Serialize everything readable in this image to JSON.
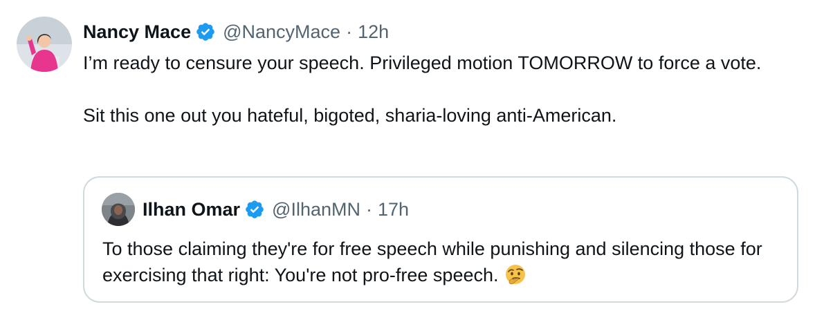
{
  "tweet": {
    "author_name": "Nancy Mace",
    "author_handle": "@NancyMace",
    "separator": "·",
    "time": "12h",
    "verified_icon": "verified-badge-icon",
    "paragraphs": [
      "I’m ready to censure your speech. Privileged motion TOMORROW to force a vote.",
      "Sit this one out you hateful, bigoted, sharia-loving anti-American."
    ]
  },
  "quote": {
    "author_name": "Ilhan Omar",
    "author_handle": "@IlhanMN",
    "separator": "·",
    "time": "17h",
    "verified_icon": "verified-badge-icon",
    "text": "To those claiming they're for free speech while punishing and silencing those for exercising that right: You're not pro-free speech.",
    "emoji_icon": "thinking-face-emoji-icon"
  },
  "colors": {
    "text_primary": "#0f1419",
    "text_secondary": "#536471",
    "verified_blue": "#1d9bf0",
    "quote_border": "#cfd9de"
  }
}
